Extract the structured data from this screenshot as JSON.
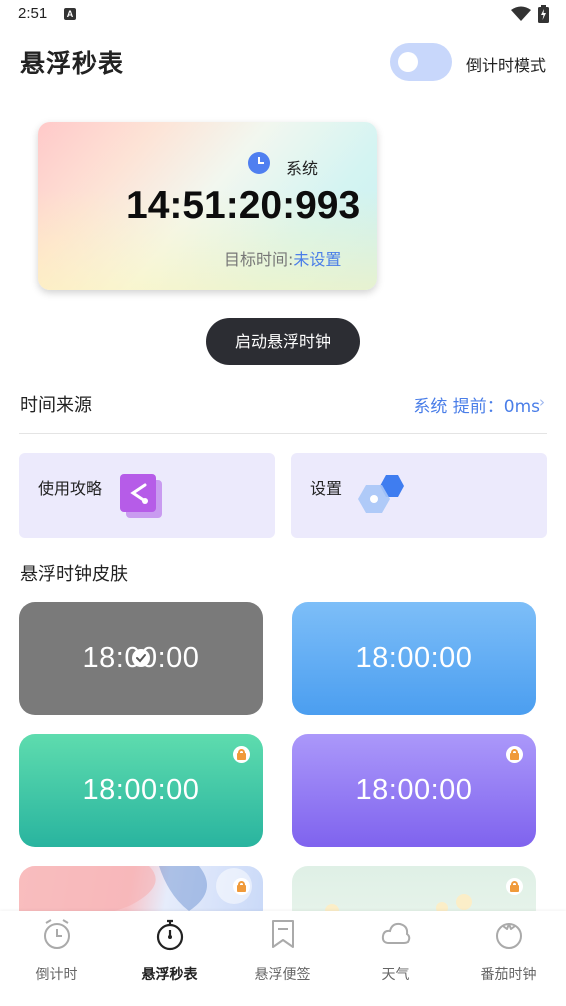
{
  "status_bar": {
    "time": "2:51",
    "notification_icon": "A"
  },
  "header": {
    "title": "悬浮秒表",
    "mode_toggle_label": "倒计时模式",
    "mode_toggle_on": false
  },
  "clock_card": {
    "source_label": "系统",
    "time": "14:51:20:993",
    "target_label": "目标时间:",
    "target_value": "未设置"
  },
  "start_button": {
    "label": "启动悬浮时钟"
  },
  "time_source": {
    "label": "时间来源",
    "value": "系统 提前：0ms",
    "chevron": "›"
  },
  "features": [
    {
      "label": "使用攻略",
      "icon": "guide-icon"
    },
    {
      "label": "设置",
      "icon": "settings-hex-icon"
    }
  ],
  "skins": {
    "title": "悬浮时钟皮肤",
    "tiles": [
      {
        "time": "18:00:00",
        "style": "gray",
        "selected": true,
        "locked": false
      },
      {
        "time": "18:00:00",
        "style": "blue",
        "selected": false,
        "locked": false
      },
      {
        "time": "18:00:00",
        "style": "green",
        "selected": false,
        "locked": true
      },
      {
        "time": "18:00:00",
        "style": "purple",
        "selected": false,
        "locked": true
      },
      {
        "time": "",
        "style": "floral",
        "selected": false,
        "locked": true
      },
      {
        "time": "",
        "style": "mint",
        "selected": false,
        "locked": true
      }
    ]
  },
  "bottom_nav": {
    "items": [
      {
        "label": "倒计时",
        "icon": "alarm-clock-icon",
        "active": false
      },
      {
        "label": "悬浮秒表",
        "icon": "stopwatch-icon",
        "active": true
      },
      {
        "label": "悬浮便签",
        "icon": "bookmark-icon",
        "active": false
      },
      {
        "label": "天气",
        "icon": "cloud-icon",
        "active": false
      },
      {
        "label": "番茄时钟",
        "icon": "tomato-icon",
        "active": false
      }
    ]
  },
  "colors": {
    "accent": "#4a7ee8",
    "button_dark": "#2c2d33",
    "card_bg": "#eceafc"
  }
}
